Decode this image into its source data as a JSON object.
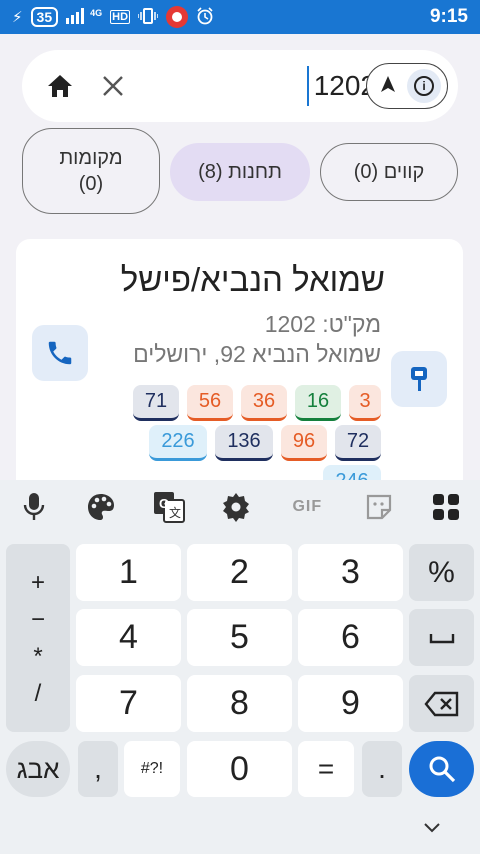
{
  "status": {
    "battery": "35",
    "network": "4G",
    "hd": "HD",
    "time": "9:15"
  },
  "search": {
    "value": "1202",
    "placeholder": ""
  },
  "chips": {
    "places": "מקומות\n(0)",
    "stations": "תחנות (8)",
    "lines": "קווים (0)"
  },
  "result": {
    "name": "שמואל הנביא/פישל",
    "code": "מק\"ט: 1202",
    "address": "שמואל הנביא 92, ירושלים",
    "lines": [
      {
        "label": "3",
        "color": "#e55c26",
        "bg": "#fbe6de"
      },
      {
        "label": "16",
        "color": "#15803d",
        "bg": "#e0f0e3"
      },
      {
        "label": "36",
        "color": "#e55c26",
        "bg": "#fbe6de"
      },
      {
        "label": "56",
        "color": "#e55c26",
        "bg": "#fbe6de"
      },
      {
        "label": "71",
        "color": "#1f2f5f",
        "bg": "#e2e5ec"
      },
      {
        "label": "72",
        "color": "#1f2f5f",
        "bg": "#e2e5ec"
      },
      {
        "label": "96",
        "color": "#e55c26",
        "bg": "#fbe6de"
      },
      {
        "label": "136",
        "color": "#1f2f5f",
        "bg": "#e2e5ec"
      },
      {
        "label": "226",
        "color": "#3a9ad9",
        "bg": "#dff0fa"
      },
      {
        "label": "246",
        "color": "#3a9ad9",
        "bg": "#dff0fa"
      }
    ]
  },
  "keyboard": {
    "tools": [
      "mic-icon",
      "palette-icon",
      "translate-icon",
      "gear-icon",
      "GIF",
      "sticker-icon",
      "apps-grid-icon"
    ],
    "gif": "GIF",
    "keys": {
      "k1": "1",
      "k2": "2",
      "k3": "3",
      "k4": "4",
      "k5": "5",
      "k6": "6",
      "k7": "7",
      "k8": "8",
      "k9": "9",
      "k0": "0",
      "percent": "%",
      "comma": ",",
      "symbols": "#?!",
      "equals": "=",
      "dot": ".",
      "lang": "אבג",
      "ops": "+\n−\n*\n/"
    }
  }
}
